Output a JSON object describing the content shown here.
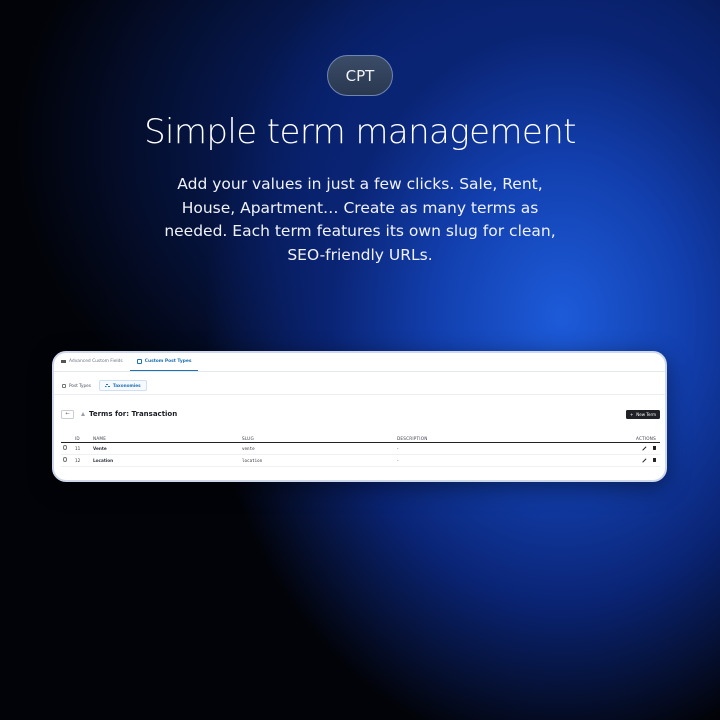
{
  "badge": {
    "label": "CPT"
  },
  "headline": "Simple term management",
  "subtext": "Add your values in just a few clicks. Sale, Rent, House, Apartment… Create as many terms as needed. Each term features its own slug for clean, SEO-friendly URLs.",
  "card": {
    "topnav": [
      {
        "label": "Advanced Custom Fields",
        "icon": "list-icon",
        "active": false
      },
      {
        "label": "Custom Post Types",
        "icon": "cpt-icon",
        "active": true
      }
    ],
    "subnav": [
      {
        "label": "Post Types",
        "icon": "database-icon",
        "active": false
      },
      {
        "label": "Taxonomies",
        "icon": "taxonomy-icon",
        "active": true
      }
    ],
    "back_label": "←",
    "title": "Terms for: Transaction",
    "new_term_label": "New Term",
    "new_term_plus": "+",
    "table": {
      "headers": {
        "id": "ID",
        "name": "NAME",
        "slug": "SLUG",
        "description": "DESCRIPTION",
        "actions": "ACTIONS"
      },
      "rows": [
        {
          "id": "11",
          "name": "Vente",
          "slug": "vente",
          "description": "-"
        },
        {
          "id": "12",
          "name": "Location",
          "slug": "location",
          "description": "-"
        }
      ]
    }
  },
  "colors": {
    "accent": "#2271b1",
    "background_glow": "#1d5bd9"
  }
}
